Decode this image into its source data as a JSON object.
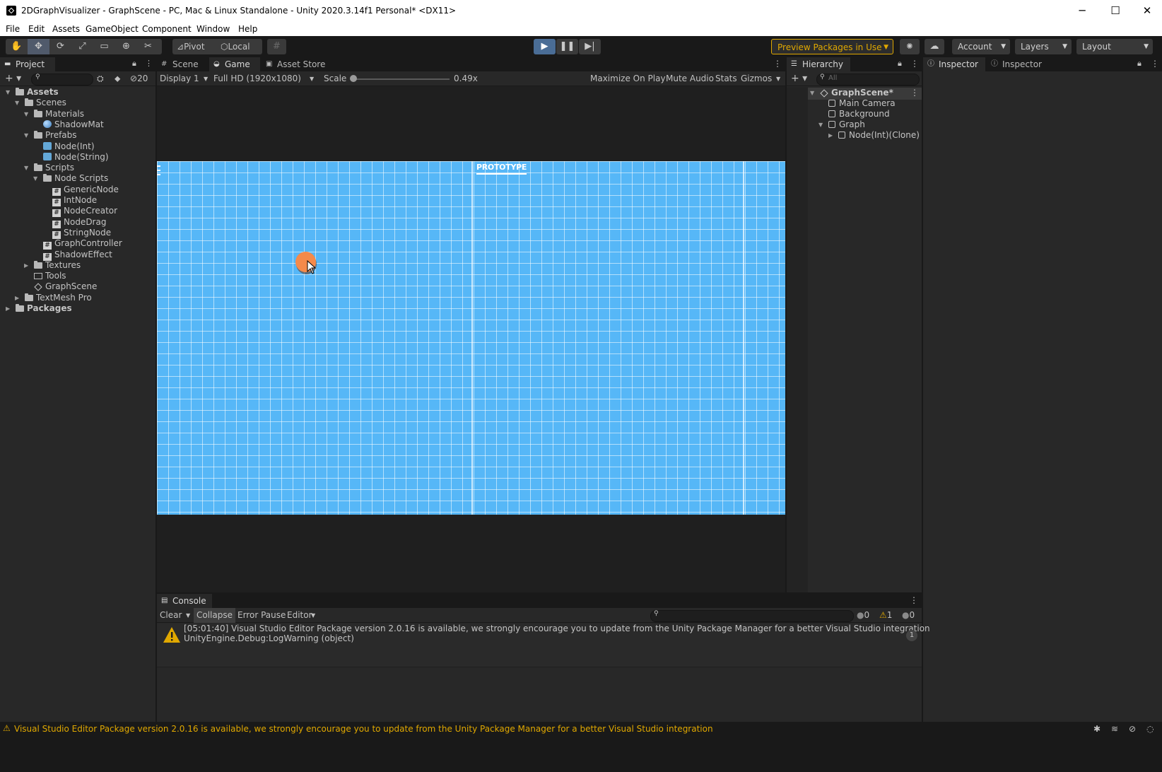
{
  "window": {
    "title": "2DGraphVisualizer - GraphScene - PC, Mac & Linux Standalone - Unity 2020.3.14f1 Personal* <DX11>",
    "controls": {
      "minimize": "─",
      "maximize": "☐",
      "close": "✕"
    }
  },
  "menu": [
    "File",
    "Edit",
    "Assets",
    "GameObject",
    "Component",
    "Window",
    "Help"
  ],
  "toolbar": {
    "tools": [
      "hand-icon",
      "move-icon",
      "rotate-icon",
      "scale-icon",
      "rect-icon",
      "transform-icon",
      "custom-tool-icon"
    ],
    "pivot_label": "Pivot",
    "local_label": "Local",
    "play_state": "playing",
    "preview_packages_label": "Preview Packages in Use",
    "account_label": "Account",
    "layers_label": "Layers",
    "layout_label": "Layout"
  },
  "project": {
    "tab_label": "Project",
    "hidden_count": "20",
    "tree": [
      {
        "label": "Assets",
        "icon": "folder",
        "bold": true
      },
      {
        "label": "Scenes",
        "icon": "folder"
      },
      {
        "label": "Materials",
        "icon": "folder"
      },
      {
        "label": "ShadowMat",
        "icon": "material"
      },
      {
        "label": "Prefabs",
        "icon": "folder"
      },
      {
        "label": "Node(Int)",
        "icon": "prefab"
      },
      {
        "label": "Node(String)",
        "icon": "prefab"
      },
      {
        "label": "Scripts",
        "icon": "folder"
      },
      {
        "label": "Node Scripts",
        "icon": "folder"
      },
      {
        "label": "GenericNode",
        "icon": "script"
      },
      {
        "label": "IntNode",
        "icon": "script"
      },
      {
        "label": "NodeCreator",
        "icon": "script"
      },
      {
        "label": "NodeDrag",
        "icon": "script"
      },
      {
        "label": "StringNode",
        "icon": "script"
      },
      {
        "label": "GraphController",
        "icon": "script"
      },
      {
        "label": "ShadowEffect",
        "icon": "script"
      },
      {
        "label": "Textures",
        "icon": "folder"
      },
      {
        "label": "Tools",
        "icon": "folder-empty"
      },
      {
        "label": "GraphScene",
        "icon": "scene"
      },
      {
        "label": "TextMesh Pro",
        "icon": "folder"
      },
      {
        "label": "Packages",
        "icon": "folder",
        "bold": true
      }
    ]
  },
  "center": {
    "tabs": [
      "Scene",
      "Game",
      "Asset Store"
    ],
    "display_label": "Display 1",
    "resolution_label": "Full HD (1920x1080)",
    "scale_label": "Scale",
    "scale_value": "0.49x",
    "scale_fraction": 0.0,
    "maximize_label": "Maximize On Play",
    "mute_label": "Mute Audio",
    "stats_label": "Stats",
    "gizmos_label": "Gizmos",
    "game": {
      "prototype_text": "PROTOTYPE",
      "background_color": "#56b7f7",
      "node_color": "#f58a4a"
    }
  },
  "hierarchy": {
    "tab_label": "Hierarchy",
    "search_placeholder": "All",
    "items": [
      {
        "label": "GraphScene*",
        "icon": "scene"
      },
      {
        "label": "Main Camera",
        "icon": "gameobject"
      },
      {
        "label": "Background",
        "icon": "gameobject"
      },
      {
        "label": "Graph",
        "icon": "gameobject"
      },
      {
        "label": "Node(Int)(Clone)",
        "icon": "gameobject"
      }
    ]
  },
  "inspector": {
    "tabs": [
      "Inspector",
      "Inspector"
    ]
  },
  "console": {
    "tab_label": "Console",
    "clear_label": "Clear",
    "collapse_label": "Collapse",
    "error_pause_label": "Error Pause",
    "editor_label": "Editor",
    "counts": {
      "log": "0",
      "warning": "1",
      "error": "0"
    },
    "message_line1": "[05:01:40] Visual Studio Editor Package version 2.0.16 is available, we strongly encourage you to update from the Unity Package Manager for a better Visual Studio integration",
    "message_line2": "UnityEngine.Debug:LogWarning (object)",
    "message_count": "1"
  },
  "status": {
    "message": "Visual Studio Editor Package version 2.0.16 is available, we strongly encourage you to update from the Unity Package Manager for a better Visual Studio integration",
    "warning_color": "#e0a800"
  }
}
